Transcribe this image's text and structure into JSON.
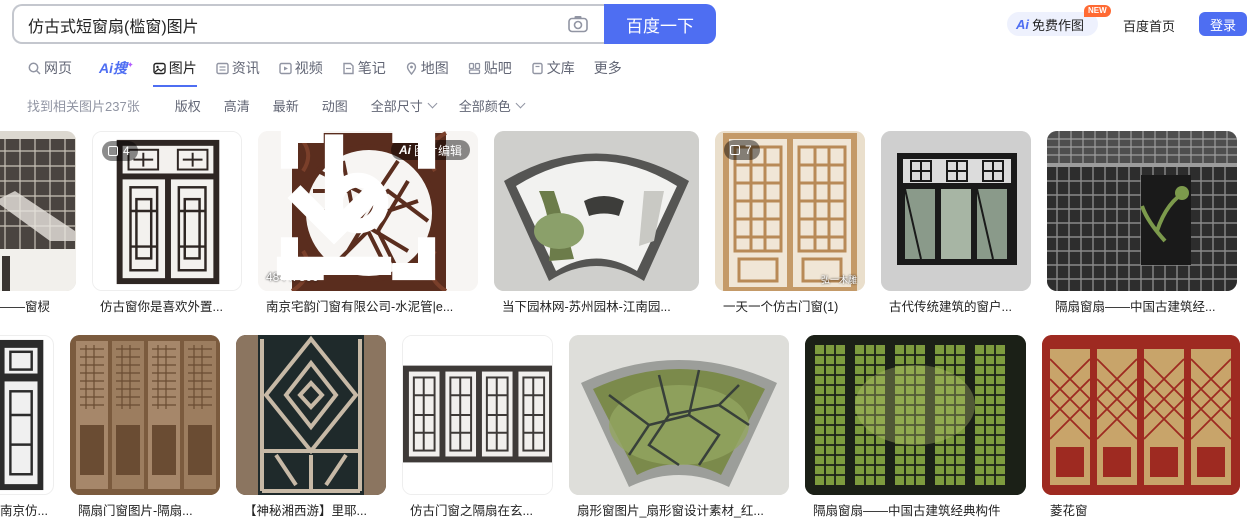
{
  "search": {
    "query": "仿古式短窗扇(槛窗)图片",
    "button_label": "百度一下"
  },
  "top_right": {
    "ai_logo": "Ai",
    "ai_draw_label": "免费作图",
    "new_badge": "NEW",
    "home_label": "百度首页",
    "login_label": "登录"
  },
  "tabs": [
    {
      "label": "网页",
      "icon": "search-icon",
      "active": false
    },
    {
      "label": "Ai搜",
      "icon": "ai-search-logo",
      "active": false
    },
    {
      "label": "图片",
      "icon": "image-icon",
      "active": true
    },
    {
      "label": "资讯",
      "icon": "news-icon",
      "active": false
    },
    {
      "label": "视频",
      "icon": "video-icon",
      "active": false
    },
    {
      "label": "笔记",
      "icon": "note-icon",
      "active": false
    },
    {
      "label": "地图",
      "icon": "map-pin-icon",
      "active": false
    },
    {
      "label": "贴吧",
      "icon": "tieba-icon",
      "active": false
    },
    {
      "label": "文库",
      "icon": "library-icon",
      "active": false
    },
    {
      "label": "更多",
      "icon": "",
      "active": false
    }
  ],
  "filters": {
    "result_count": "找到相关图片237张",
    "items": [
      "版权",
      "高清",
      "最新",
      "动图",
      "全部尺寸",
      "全部颜色"
    ]
  },
  "row1": [
    {
      "caption": "——窗棂"
    },
    {
      "caption": "仿古窗你是喜欢外置...",
      "badge_count": "4"
    },
    {
      "caption": "南京宅韵门窗有限公司-水泥管|e...",
      "edit_logo": "Ai",
      "edit_label": "图片编辑",
      "size": "484 x 300"
    },
    {
      "caption": "当下园林网-苏州园林-江南园..."
    },
    {
      "caption": "一天一个仿古门窗(1)",
      "badge_count": "7",
      "watermark": "弘一木雕"
    },
    {
      "caption": "古代传统建筑的窗户..."
    },
    {
      "caption": "隔扇窗扇——中国古建筑经..."
    }
  ],
  "row2": [
    {
      "caption": "南京仿..."
    },
    {
      "caption": "隔扇门窗图片-隔扇..."
    },
    {
      "caption": "【神秘湘西游】里耶..."
    },
    {
      "caption": "仿古门窗之隔扇在玄..."
    },
    {
      "caption": "扇形窗图片_扇形窗设计素材_红..."
    },
    {
      "caption": "隔扇窗扇——中国古建筑经典构件"
    },
    {
      "caption": "菱花窗"
    }
  ],
  "colors": {
    "accent": "#4e6ef2",
    "tab_text": "#626675",
    "muted_text": "#9195a3",
    "new_badge": "#ff6a33"
  }
}
